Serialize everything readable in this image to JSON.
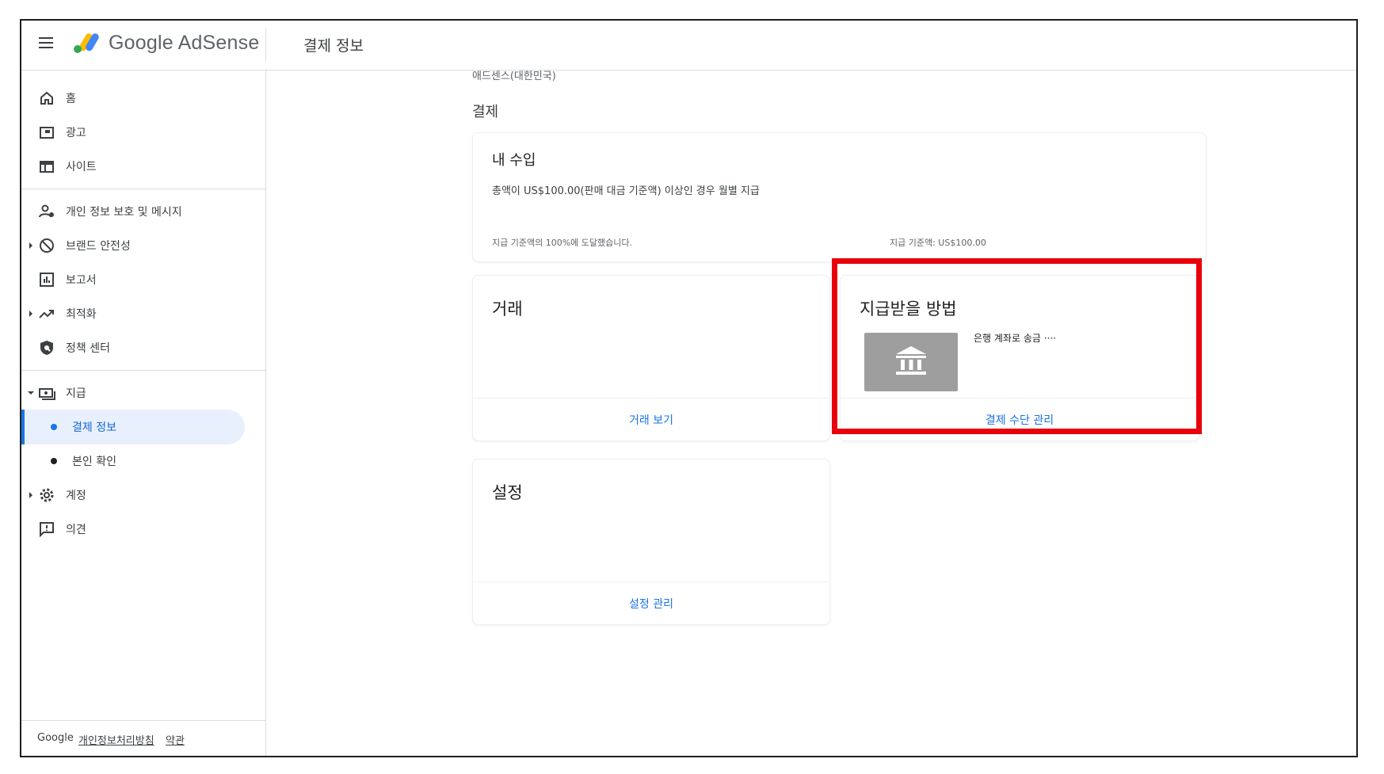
{
  "header": {
    "brand": "Google AdSense",
    "page_title": "결제 정보"
  },
  "sidebar": {
    "items": [
      {
        "label": "홈",
        "icon": "home-icon"
      },
      {
        "label": "광고",
        "icon": "ads-icon"
      },
      {
        "label": "사이트",
        "icon": "sites-icon"
      },
      {
        "label": "개인 정보 보호 및 메시지",
        "icon": "privacy-icon"
      },
      {
        "label": "브랜드 안전성",
        "icon": "block-icon"
      },
      {
        "label": "보고서",
        "icon": "reports-icon"
      },
      {
        "label": "최적화",
        "icon": "trending-icon"
      },
      {
        "label": "정책 센터",
        "icon": "shield-icon"
      },
      {
        "label": "지급",
        "icon": "payments-icon"
      },
      {
        "label": "계정",
        "icon": "gear-icon"
      },
      {
        "label": "의견",
        "icon": "feedback-icon"
      }
    ],
    "sub_items": [
      {
        "label": "결제 정보"
      },
      {
        "label": "본인 확인"
      }
    ],
    "footer": {
      "google": "Google",
      "privacy": "개인정보처리방침",
      "terms": "약관"
    }
  },
  "main": {
    "breadcrumb": "애드센스(대한민국)",
    "section_title": "결제",
    "earnings": {
      "title": "내 수입",
      "description": "총액이 US$100.00(판매 대금 기준액) 이상인 경우 월별 지급",
      "progress_text": "지급 기준액의 100%에 도달했습니다.",
      "threshold_text": "지급 기준액: US$100.00"
    },
    "transactions": {
      "title": "거래",
      "link": "거래 보기"
    },
    "payment_method": {
      "title": "지급받을 방법",
      "method_text": "은행 계좌로 송금 ····",
      "link": "결제 수단 관리"
    },
    "settings": {
      "title": "설정",
      "link": "설정 관리"
    }
  },
  "colors": {
    "accent": "#1a73e8",
    "highlight": "#e8000b",
    "active_bg": "#e8f0fe"
  }
}
